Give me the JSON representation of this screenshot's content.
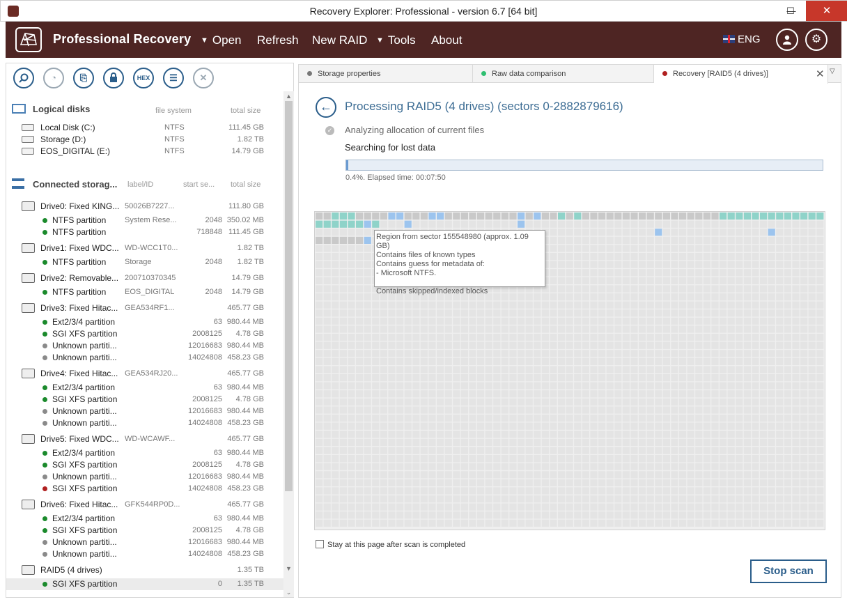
{
  "window": {
    "title": "Recovery Explorer: Professional - version 6.7 [64 bit]",
    "minimize": "—",
    "maximize": "☐",
    "close": "✕"
  },
  "menu": {
    "brand": "Professional Recovery",
    "items": [
      "Open",
      "Refresh",
      "New RAID",
      "Tools",
      "About"
    ],
    "language": "ENG"
  },
  "toolbar": {
    "icons": [
      "search-icon",
      "scan-icon",
      "image-icon",
      "lock-icon",
      "hex-icon",
      "list-icon",
      "close-icon"
    ],
    "hex_label": "HEX"
  },
  "logical": {
    "title": "Logical disks",
    "col_fs": "file system",
    "col_size": "total size",
    "rows": [
      {
        "name": "Local Disk (C:)",
        "fs": "NTFS",
        "size": "111.45 GB"
      },
      {
        "name": "Storage (D:)",
        "fs": "NTFS",
        "size": "1.82 TB"
      },
      {
        "name": "EOS_DIGITAL (E:)",
        "fs": "NTFS",
        "size": "14.79 GB"
      }
    ]
  },
  "storage": {
    "title": "Connected storag...",
    "col_label": "label/ID",
    "col_start": "start se...",
    "col_size": "total size",
    "drives": [
      {
        "name": "Drive0: Fixed KING...",
        "id": "50026B7227...",
        "size": "111.80 GB",
        "parts": [
          {
            "name": "NTFS partition",
            "label": "System Rese...",
            "start": "2048",
            "size": "350.02 MB",
            "color": "#1b8a2c"
          },
          {
            "name": "NTFS partition",
            "label": "",
            "start": "718848",
            "size": "111.45 GB",
            "color": "#1b8a2c"
          }
        ]
      },
      {
        "name": "Drive1: Fixed WDC...",
        "id": "WD-WCC1T0...",
        "size": "1.82 TB",
        "parts": [
          {
            "name": "NTFS partition",
            "label": "Storage",
            "start": "2048",
            "size": "1.82 TB",
            "color": "#1b8a2c"
          }
        ]
      },
      {
        "name": "Drive2: Removable...",
        "id": "200710370345",
        "size": "14.79 GB",
        "parts": [
          {
            "name": "NTFS partition",
            "label": "EOS_DIGITAL",
            "start": "2048",
            "size": "14.79 GB",
            "color": "#1b8a2c"
          }
        ]
      },
      {
        "name": "Drive3: Fixed Hitac...",
        "id": "GEA534RF1...",
        "size": "465.77 GB",
        "parts": [
          {
            "name": "Ext2/3/4 partition",
            "label": "",
            "start": "63",
            "size": "980.44 MB",
            "color": "#1b8a2c"
          },
          {
            "name": "SGI XFS partition",
            "label": "",
            "start": "2008125",
            "size": "4.78 GB",
            "color": "#1b8a2c"
          },
          {
            "name": "Unknown partiti...",
            "label": "",
            "start": "12016683",
            "size": "980.44 MB",
            "color": "#8a8a8a"
          },
          {
            "name": "Unknown partiti...",
            "label": "",
            "start": "14024808",
            "size": "458.23 GB",
            "color": "#8a8a8a"
          }
        ]
      },
      {
        "name": "Drive4: Fixed Hitac...",
        "id": "GEA534RJ20...",
        "size": "465.77 GB",
        "parts": [
          {
            "name": "Ext2/3/4 partition",
            "label": "",
            "start": "63",
            "size": "980.44 MB",
            "color": "#1b8a2c"
          },
          {
            "name": "SGI XFS partition",
            "label": "",
            "start": "2008125",
            "size": "4.78 GB",
            "color": "#1b8a2c"
          },
          {
            "name": "Unknown partiti...",
            "label": "",
            "start": "12016683",
            "size": "980.44 MB",
            "color": "#8a8a8a"
          },
          {
            "name": "Unknown partiti...",
            "label": "",
            "start": "14024808",
            "size": "458.23 GB",
            "color": "#8a8a8a"
          }
        ]
      },
      {
        "name": "Drive5: Fixed WDC...",
        "id": "WD-WCAWF...",
        "size": "465.77 GB",
        "parts": [
          {
            "name": "Ext2/3/4 partition",
            "label": "",
            "start": "63",
            "size": "980.44 MB",
            "color": "#1b8a2c"
          },
          {
            "name": "SGI XFS partition",
            "label": "",
            "start": "2008125",
            "size": "4.78 GB",
            "color": "#1b8a2c"
          },
          {
            "name": "Unknown partiti...",
            "label": "",
            "start": "12016683",
            "size": "980.44 MB",
            "color": "#8a8a8a"
          },
          {
            "name": "SGI XFS partition",
            "label": "",
            "start": "14024808",
            "size": "458.23 GB",
            "color": "#b02020"
          }
        ]
      },
      {
        "name": "Drive6: Fixed Hitac...",
        "id": "GFK544RP0D...",
        "size": "465.77 GB",
        "parts": [
          {
            "name": "Ext2/3/4 partition",
            "label": "",
            "start": "63",
            "size": "980.44 MB",
            "color": "#1b8a2c"
          },
          {
            "name": "SGI XFS partition",
            "label": "",
            "start": "2008125",
            "size": "4.78 GB",
            "color": "#1b8a2c"
          },
          {
            "name": "Unknown partiti...",
            "label": "",
            "start": "12016683",
            "size": "980.44 MB",
            "color": "#8a8a8a"
          },
          {
            "name": "Unknown partiti...",
            "label": "",
            "start": "14024808",
            "size": "458.23 GB",
            "color": "#8a8a8a"
          }
        ]
      },
      {
        "name": "RAID5 (4 drives)",
        "id": "",
        "size": "1.35 TB",
        "parts": [
          {
            "name": "SGI XFS partition",
            "label": "",
            "start": "0",
            "size": "1.35 TB",
            "color": "#1b8a2c"
          }
        ]
      }
    ]
  },
  "tabs": [
    {
      "label": "Storage properties",
      "color": "#777777"
    },
    {
      "label": "Raw data comparison",
      "color": "#2fbf71"
    },
    {
      "label": "Recovery [RAID5 (4 drives)]",
      "color": "#b02020"
    }
  ],
  "process": {
    "title": "Processing RAID5 (4 drives) (sectors 0-2882879616)",
    "step_done": "Analyzing allocation of current files",
    "step_active": "Searching for lost data",
    "progress_fraction": 0.004,
    "progress_text": "0.4%. Elapsed time: 00:07:50"
  },
  "tooltip": [
    "Region from sector 155548980 (approx. 1.09 GB)",
    "Contains files of known types",
    "Contains guess for metadata of:",
    " - Microsoft NTFS.",
    "",
    "Contains skipped/indexed blocks"
  ],
  "footer": {
    "stay_label": "Stay at this page after scan is completed",
    "stop_label": "Stop scan"
  },
  "colors": {
    "menu_bg": "#4e2523",
    "accent": "#2a5d8a",
    "cell_empty": "#e4e4e4",
    "cell_scanned": "#c9c9c9",
    "cell_teal": "#8fd3c9",
    "cell_blue": "#9cc4ee"
  }
}
